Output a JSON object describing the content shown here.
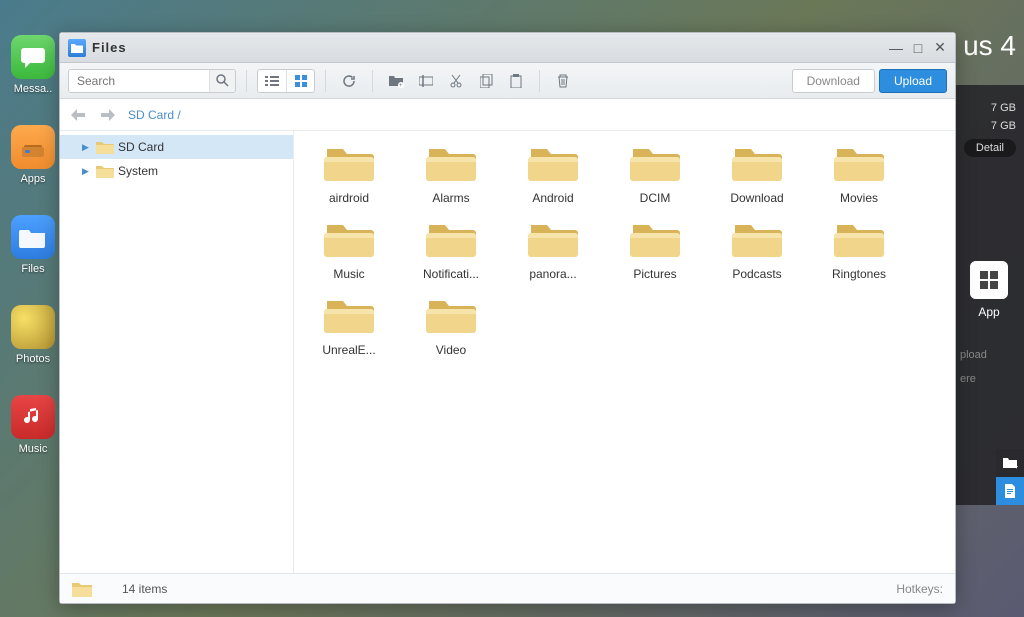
{
  "desktop": {
    "icons": [
      {
        "label": "Messa..",
        "type": "messa"
      },
      {
        "label": "Apps",
        "type": "apps"
      },
      {
        "label": "Files",
        "type": "files"
      },
      {
        "label": "Photos",
        "type": "photos"
      },
      {
        "label": "Music",
        "type": "music"
      }
    ]
  },
  "rightPanel": {
    "deviceName": "us 4",
    "storage1": "7 GB",
    "storage2": "7 GB",
    "detailLabel": "Detail",
    "appLabel": "App",
    "uploadLabel": "pload",
    "hereLabel": "ere"
  },
  "window": {
    "title": "Files",
    "search": {
      "placeholder": "Search"
    },
    "actions": {
      "download": "Download",
      "upload": "Upload"
    },
    "breadcrumb": "SD Card /",
    "tree": [
      {
        "label": "SD Card",
        "selected": true
      },
      {
        "label": "System",
        "selected": false
      }
    ],
    "folders": [
      {
        "name": "airdroid"
      },
      {
        "name": "Alarms"
      },
      {
        "name": "Android"
      },
      {
        "name": "DCIM"
      },
      {
        "name": "Download"
      },
      {
        "name": "Movies"
      },
      {
        "name": "Music"
      },
      {
        "name": "Notificati..."
      },
      {
        "name": "panora..."
      },
      {
        "name": "Pictures"
      },
      {
        "name": "Podcasts"
      },
      {
        "name": "Ringtones"
      },
      {
        "name": "UnrealE..."
      },
      {
        "name": "Video"
      }
    ],
    "status": {
      "items": "14 items",
      "hotkeys": "Hotkeys:"
    }
  }
}
